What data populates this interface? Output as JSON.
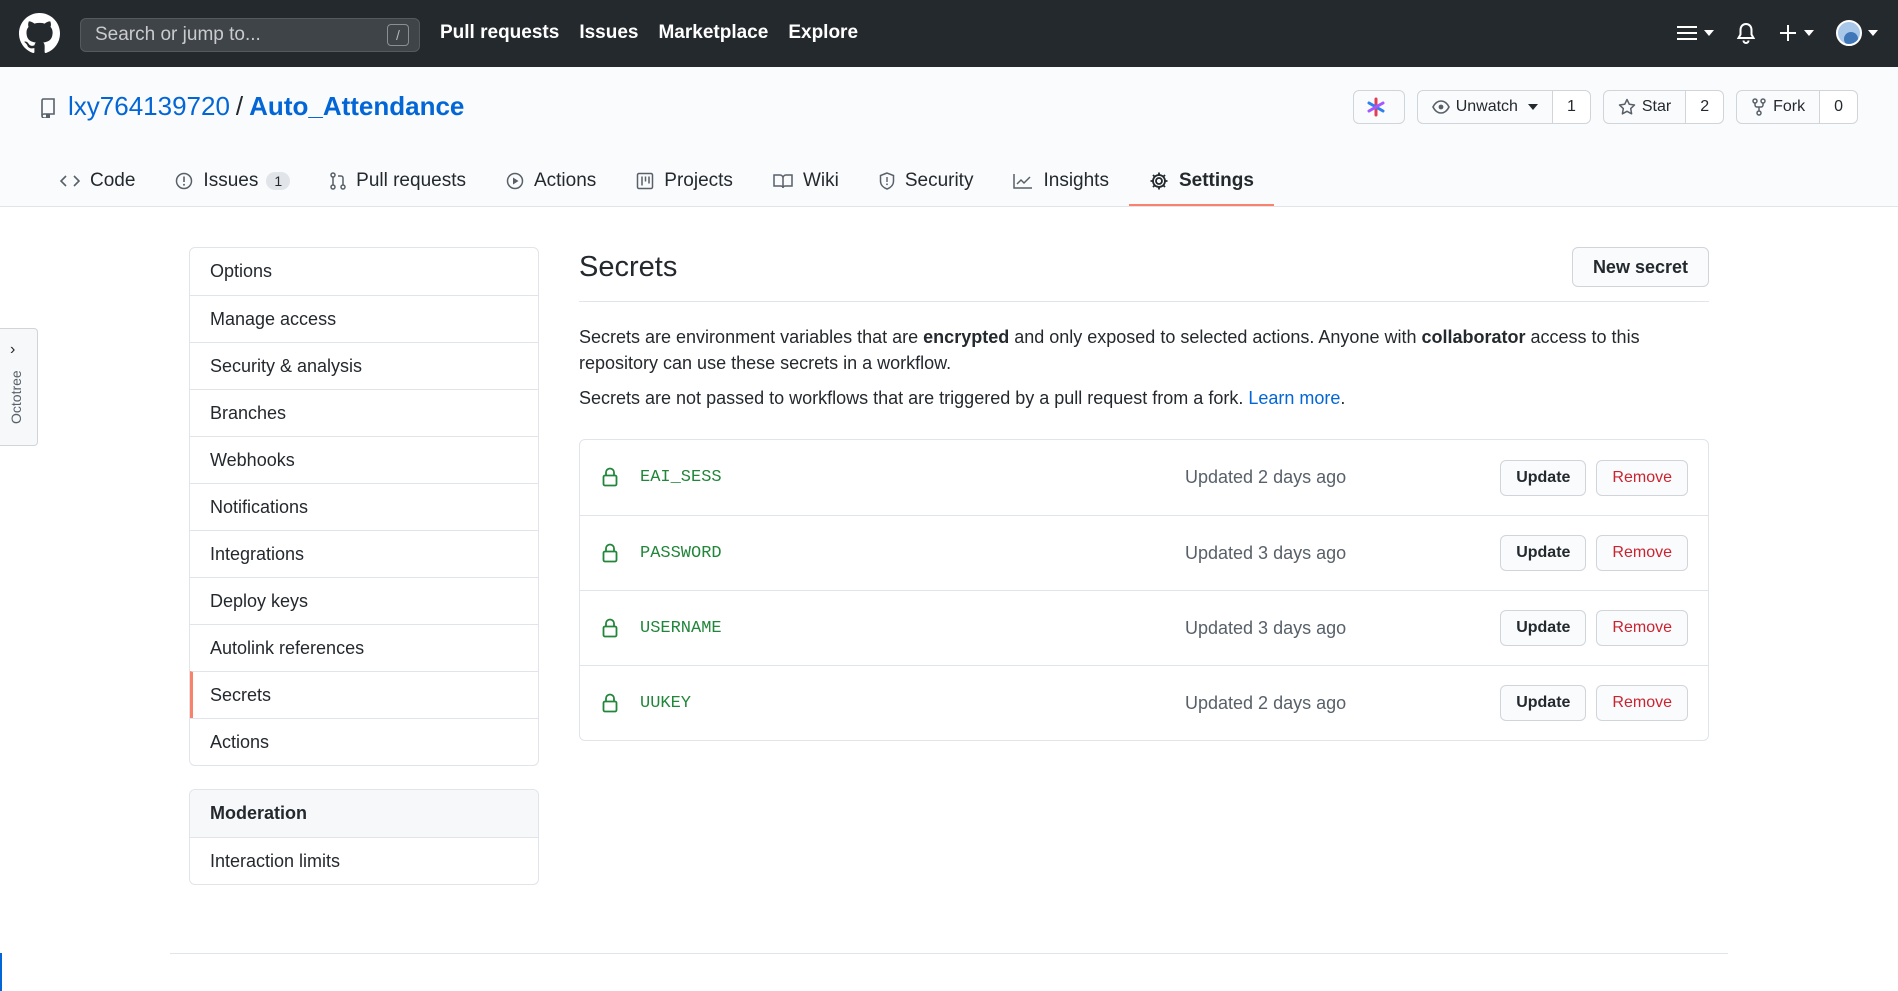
{
  "header": {
    "search_placeholder": "Search or jump to...",
    "slash_key": "/",
    "nav": [
      "Pull requests",
      "Issues",
      "Marketplace",
      "Explore"
    ]
  },
  "repo": {
    "owner": "lxy764139720",
    "separator": "/",
    "name": "Auto_Attendance",
    "watch_label": "Unwatch",
    "watch_count": "1",
    "star_label": "Star",
    "star_count": "2",
    "fork_label": "Fork",
    "fork_count": "0"
  },
  "tabs": [
    {
      "label": "Code",
      "icon": "code-icon"
    },
    {
      "label": "Issues",
      "icon": "issue-icon",
      "counter": "1"
    },
    {
      "label": "Pull requests",
      "icon": "pull-request-icon"
    },
    {
      "label": "Actions",
      "icon": "play-icon"
    },
    {
      "label": "Projects",
      "icon": "project-icon"
    },
    {
      "label": "Wiki",
      "icon": "book-icon"
    },
    {
      "label": "Security",
      "icon": "shield-icon"
    },
    {
      "label": "Insights",
      "icon": "graph-icon"
    },
    {
      "label": "Settings",
      "icon": "gear-icon",
      "active": true
    }
  ],
  "octotree": {
    "label": "Octotree"
  },
  "sidebar": {
    "items": [
      "Options",
      "Manage access",
      "Security & analysis",
      "Branches",
      "Webhooks",
      "Notifications",
      "Integrations",
      "Deploy keys",
      "Autolink references",
      "Secrets",
      "Actions"
    ],
    "selected": "Secrets",
    "moderation_heading": "Moderation",
    "moderation_items": [
      "Interaction limits"
    ]
  },
  "main": {
    "title": "Secrets",
    "new_secret_label": "New secret",
    "desc_part1": "Secrets are environment variables that are ",
    "desc_bold1": "encrypted",
    "desc_part2": " and only exposed to selected actions. Anyone with ",
    "desc_bold2": "collaborator",
    "desc_part3": " access to this repository can use these secrets in a workflow.",
    "desc2_text": "Secrets are not passed to workflows that are triggered by a pull request from a fork. ",
    "learn_more": "Learn more",
    "desc2_end": ".",
    "secrets": [
      {
        "name": "EAI_SESS",
        "updated": "Updated 2 days ago"
      },
      {
        "name": "PASSWORD",
        "updated": "Updated 3 days ago"
      },
      {
        "name": "USERNAME",
        "updated": "Updated 3 days ago"
      },
      {
        "name": "UUKEY",
        "updated": "Updated 2 days ago"
      }
    ],
    "update_label": "Update",
    "remove_label": "Remove"
  },
  "colors": {
    "header_bg": "#24292e",
    "link": "#0366d6",
    "active_tab_border": "#f9826c",
    "secret_name": "#22863a",
    "danger": "#cb2431"
  }
}
